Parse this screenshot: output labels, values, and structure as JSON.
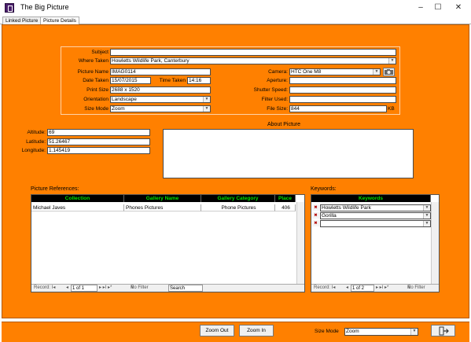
{
  "window": {
    "title": "The Big Picture",
    "minimize": "–",
    "maximize": "☐",
    "close": "✕"
  },
  "tabs": [
    {
      "label": "Linked Picture"
    },
    {
      "label": "Picture Details"
    }
  ],
  "details": {
    "subject_label": "Subject",
    "subject_value": "",
    "where_taken_label": "Where Taken",
    "where_taken_value": "Howletts Wildlife Park, Canterbury",
    "picture_name_label": "Picture Name",
    "picture_name_value": "IMAG0114",
    "date_taken_label": "Date Taken",
    "date_taken_value": "15/07/2015",
    "time_taken_label": "Time Taken",
    "time_taken_value": "14:16",
    "print_size_label": "Print Size",
    "print_size_value": "2688 x 1520",
    "orientation_label": "Orientation",
    "orientation_value": "Landscape",
    "size_mode_label": "Size Mode",
    "size_mode_value": "Zoom",
    "camera_label": "Camera:",
    "camera_value": "HTC One M8",
    "aperture_label": "Aperture:",
    "aperture_value": "",
    "shutter_label": "Shutter Speed:",
    "shutter_value": "",
    "filter_label": "Filter Used:",
    "filter_value": "",
    "file_size_label": "File Size:",
    "file_size_value": "844",
    "file_size_unit": "KB"
  },
  "location": {
    "altitude_label": "Altitude:",
    "altitude_value": "69",
    "latitude_label": "Latitude:",
    "latitude_value": "51.26467",
    "longitude_label": "Longitude:",
    "longitude_value": "1.145419"
  },
  "about": {
    "label": "About Picture",
    "value": ""
  },
  "references": {
    "label": "Picture References:",
    "headers": [
      "Collection",
      "Gallery Name",
      "Gallery Category",
      "Place"
    ],
    "row": [
      "Michael Javes",
      "Phones Pictures",
      "Phone Pictures",
      "406"
    ],
    "nav": {
      "record": "Record: I◂",
      "prev": "◂",
      "position": "1 of 1",
      "next": "▸ ▸I ▸*",
      "filter": "No Filter",
      "search": "Search"
    }
  },
  "keywords": {
    "label": "Keywords:",
    "header": "Keywords",
    "rows": [
      "Howletts Wildlife Park",
      "Gorilla",
      ""
    ],
    "nav": {
      "record": "Record: I◂",
      "prev": "◂",
      "position": "1 of 2",
      "next": "▸ ▸I ▸*",
      "filter": "No Filter"
    }
  },
  "bottom": {
    "zoom_out": "Zoom Out",
    "zoom_in": "Zoom In",
    "size_mode_label": "Size Mode",
    "size_mode_value": "Zoom",
    "exit_icon": "exit-door-icon"
  }
}
